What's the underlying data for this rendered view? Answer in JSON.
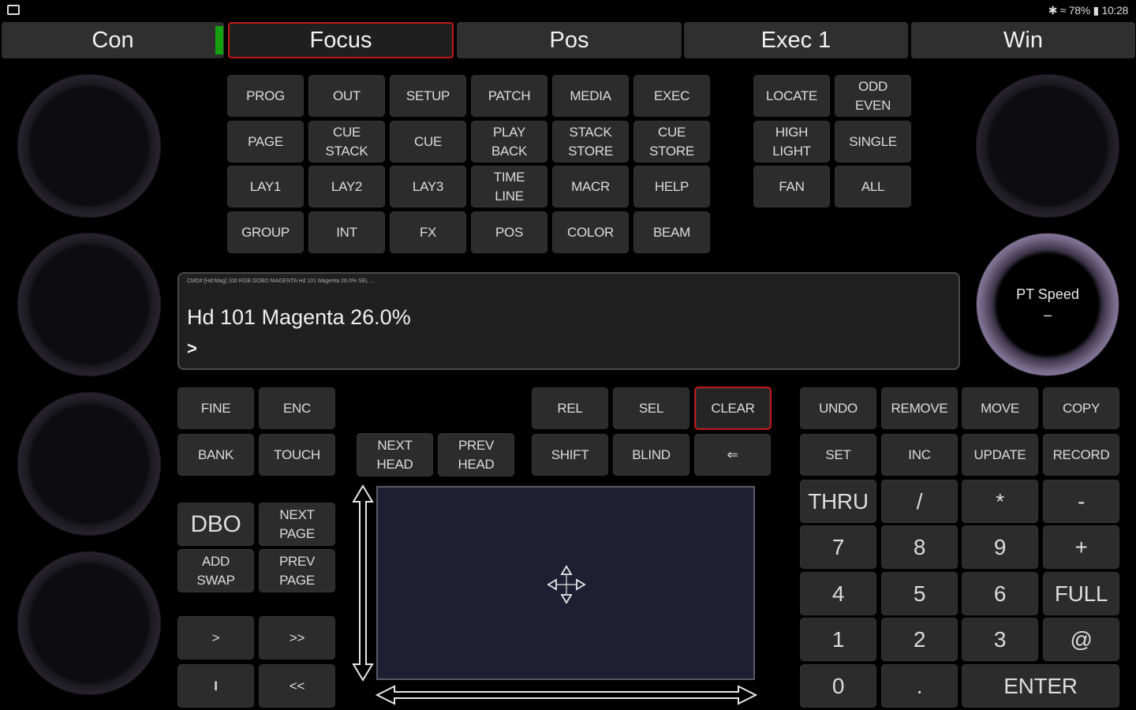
{
  "status": {
    "text": "✱ ≈ 78% ▮ 10:28"
  },
  "tabs": [
    {
      "label": "Con"
    },
    {
      "label": "Focus"
    },
    {
      "label": "Pos"
    },
    {
      "label": "Exec 1"
    },
    {
      "label": "Win"
    }
  ],
  "active_tab": "Focus",
  "function_grid": [
    [
      "PROG",
      "OUT",
      "SETUP",
      "PATCH",
      "MEDIA",
      "EXEC"
    ],
    [
      "PAGE",
      "CUE\nSTACK",
      "CUE",
      "PLAY\nBACK",
      "STACK\nSTORE",
      "CUE\nSTORE"
    ],
    [
      "LAY1",
      "LAY2",
      "LAY3",
      "TIME\nLINE",
      "MACR",
      "HELP"
    ],
    [
      "GROUP",
      "INT",
      "FX",
      "POS",
      "COLOR",
      "BEAM"
    ]
  ],
  "select_grid": [
    [
      "LOCATE",
      "ODD\nEVEN"
    ],
    [
      "HIGH\nLIGHT",
      "SINGLE"
    ],
    [
      "FAN",
      "ALL"
    ]
  ],
  "encoders": {
    "pt_speed_label": "PT Speed",
    "pt_speed_value": "–"
  },
  "command_line": {
    "history": "CMD# [Hd:Mag] 100 RGB GOBO MAGENTA Hd 101 Magenta 26.0% SEL ...",
    "output": "Hd 101 Magenta 26.0%",
    "prompt": ">"
  },
  "left_keys": {
    "fine": "FINE",
    "enc": "ENC",
    "bank": "BANK",
    "touch": "TOUCH",
    "dbo": "DBO",
    "next_page": "NEXT\nPAGE",
    "add_swap": "ADD\nSWAP",
    "prev_page": "PREV\nPAGE",
    "go": ">",
    "fast_fwd": ">>",
    "pause": "I",
    "rewind": "<<"
  },
  "head_keys": {
    "next_head": "NEXT\nHEAD",
    "prev_head": "PREV\nHEAD"
  },
  "mid_keys": {
    "rel": "REL",
    "sel": "SEL",
    "clear": "CLEAR",
    "shift": "SHIFT",
    "blind": "BLIND",
    "backspace": "⇐"
  },
  "edit_keys": {
    "undo": "UNDO",
    "remove": "REMOVE",
    "move": "MOVE",
    "copy": "COPY",
    "set": "SET",
    "inc": "INC",
    "update": "UPDATE",
    "record": "RECORD"
  },
  "keypad": [
    [
      "THRU",
      "/",
      "*",
      "-"
    ],
    [
      "7",
      "8",
      "9",
      "+"
    ],
    [
      "4",
      "5",
      "6",
      "FULL"
    ],
    [
      "1",
      "2",
      "3",
      "@"
    ]
  ],
  "keypad_bottom": {
    "zero": "0",
    "dot": ".",
    "enter": "ENTER"
  },
  "colors": {
    "accent_red": "#c0171b",
    "indicator_green": "#15a012",
    "trackpad_bg": "#1e1f32"
  }
}
